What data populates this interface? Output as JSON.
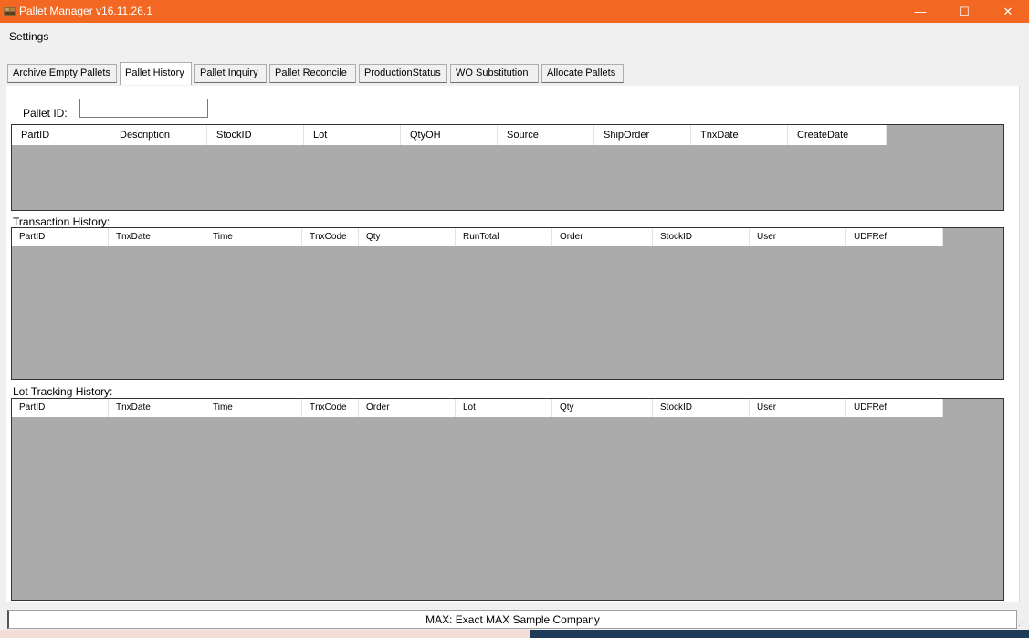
{
  "window": {
    "title": "Pallet Manager v16.11.26.1",
    "minimize_glyph": "—",
    "maximize_glyph": "☐",
    "close_glyph": "✕",
    "accent": "#f26722"
  },
  "menu": {
    "settings": "Settings"
  },
  "tabs": [
    {
      "label": "Archive Empty Pallets",
      "active": false
    },
    {
      "label": "Pallet History",
      "active": true
    },
    {
      "label": "Pallet Inquiry",
      "active": false
    },
    {
      "label": "Pallet Reconcile",
      "active": false
    },
    {
      "label": "ProductionStatus",
      "active": false
    },
    {
      "label": "WO Substitution",
      "active": false
    },
    {
      "label": "Allocate Pallets",
      "active": false
    }
  ],
  "pallet": {
    "id_label": "Pallet ID:",
    "id_value": ""
  },
  "pallet_grid": {
    "columns": [
      "PartID",
      "Description",
      "StockID",
      "Lot",
      "QtyOH",
      "Source",
      "ShipOrder",
      "TnxDate",
      "CreateDate"
    ],
    "rows": []
  },
  "transaction_history": {
    "label": "Transaction History:",
    "columns": [
      "PartID",
      "TnxDate",
      "Time",
      "TnxCode",
      "Qty",
      "RunTotal",
      "Order",
      "StockID",
      "User",
      "UDFRef"
    ],
    "rows": []
  },
  "lot_tracking_history": {
    "label": "Lot Tracking History:",
    "columns": [
      "PartID",
      "TnxDate",
      "Time",
      "TnxCode",
      "Order",
      "Lot",
      "Qty",
      "StockID",
      "User",
      "UDFRef"
    ],
    "rows": []
  },
  "status": {
    "text": "MAX: Exact MAX Sample Company"
  }
}
